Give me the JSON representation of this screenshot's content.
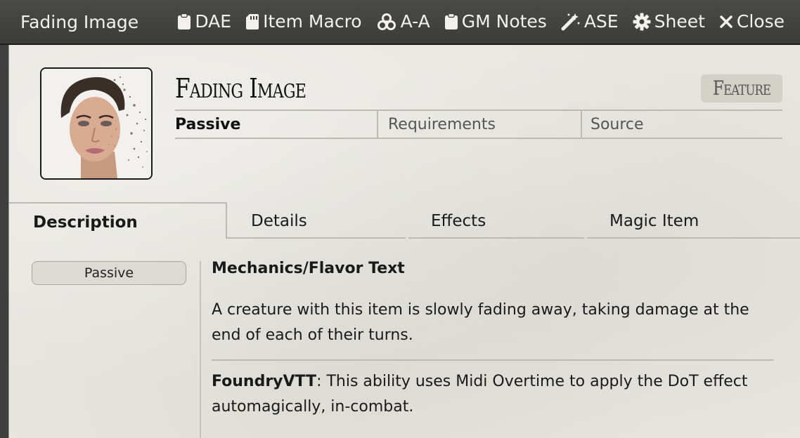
{
  "window": {
    "title": "Fading Image",
    "header_buttons": [
      {
        "label": "DAE",
        "icon": "clipboard-icon"
      },
      {
        "label": "Item Macro",
        "icon": "sd-card-icon"
      },
      {
        "label": "A-A",
        "icon": "biohazard-icon"
      },
      {
        "label": "GM Notes",
        "icon": "clipboard-icon"
      },
      {
        "label": "ASE",
        "icon": "magic-wand-icon"
      },
      {
        "label": "Sheet",
        "icon": "gear-icon"
      },
      {
        "label": "Close",
        "icon": "close-icon"
      }
    ]
  },
  "item": {
    "name": "Fading Image",
    "type": "Feature",
    "activation": "Passive",
    "requirements_placeholder": "Requirements",
    "source_placeholder": "Source"
  },
  "tabs": [
    "Description",
    "Details",
    "Effects",
    "Magic Item"
  ],
  "sidebar": {
    "activation_pill": "Passive"
  },
  "description": {
    "heading": "Mechanics/Flavor Text",
    "body": "A creature with this item is slowly fading away, taking damage at the end of each of their turns.",
    "note_label": "FoundryVTT",
    "note_text": ": This ability uses Midi Overtime to apply the DoT effect automagically, in-combat."
  }
}
